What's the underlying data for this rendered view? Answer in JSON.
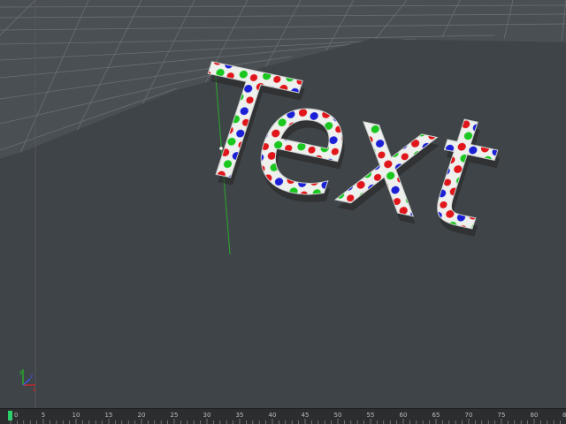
{
  "viewport": {
    "text_object": "Text",
    "colors": {
      "background": "#3b4044",
      "floor_plane": "#3f4448",
      "grid_line": "#6a6f73",
      "text_fill": "#eef0ee",
      "dot_red": "#e0161b",
      "dot_green": "#19c71f",
      "dot_blue": "#1b1fd6",
      "spline": "#2f9a2f"
    },
    "axis_gizmo": {
      "labels": [
        "y",
        "x",
        "z"
      ]
    }
  },
  "timeline": {
    "ticks": [
      "0",
      "5",
      "10",
      "15",
      "20",
      "25",
      "30",
      "35",
      "40",
      "45",
      "50",
      "55",
      "60",
      "65",
      "70",
      "75",
      "80"
    ],
    "last_tick_partial": "8",
    "current_frame": 0
  }
}
